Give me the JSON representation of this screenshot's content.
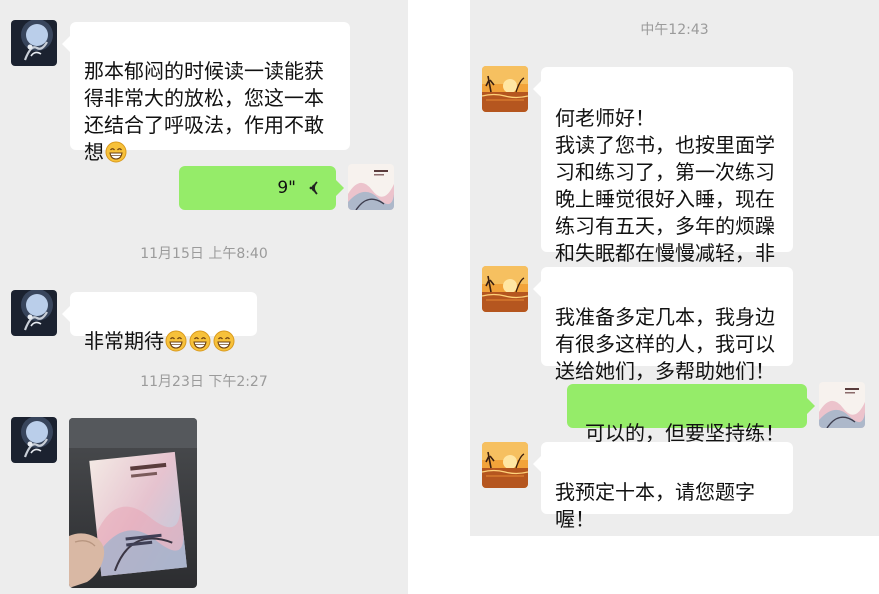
{
  "left_chat": {
    "messages": [
      {
        "text": "那本郁闷的时候读一读能获得非常大的放松，您这一本还结合了呼吸法，作用不敢想"
      },
      {
        "voice_duration": "9\""
      },
      {
        "text": "非常期待"
      }
    ],
    "timestamps": [
      "11月15日 上午8:40",
      "11月23日 下午2:27"
    ]
  },
  "right_chat": {
    "timestamp": "中午12:43",
    "messages": [
      {
        "text": "何老师好！\n我读了您书，也按里面学习和练习了，第一次练习晚上睡觉很好入睡，现在练习有五天，多年的烦躁和失眠都在慢慢减轻，非常感谢您！"
      },
      {
        "text": "我准备多定几本，我身边有很多这样的人，我可以送给她们，多帮助她们！"
      },
      {
        "text": "可以的，但要坚持练！"
      },
      {
        "text": "我预定十本，请您题字喔！"
      }
    ]
  },
  "colors": {
    "chat_background": "#ededed",
    "incoming_bubble": "#ffffff",
    "outgoing_bubble": "#95ec69",
    "timestamp_text": "#9b9b9b"
  }
}
